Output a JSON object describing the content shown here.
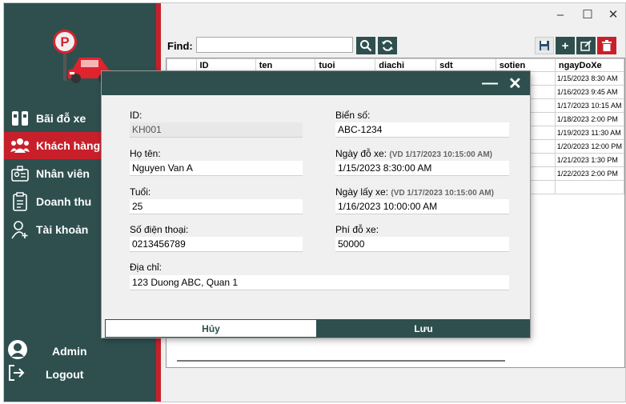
{
  "window": {
    "min_symbol": "–",
    "max_symbol": "☐",
    "close_symbol": "✕"
  },
  "sidebar": {
    "items": [
      {
        "label": "Bãi đỗ xe",
        "icon": "parking-lot-icon"
      },
      {
        "label": "Khách hàng",
        "icon": "users-icon",
        "active": true
      },
      {
        "label": "Nhân viên",
        "icon": "staff-icon"
      },
      {
        "label": "Doanh thu",
        "icon": "revenue-icon"
      },
      {
        "label": "Tài khoản",
        "icon": "add-account-icon"
      }
    ],
    "user_label": "Admin",
    "logout_label": "Logout",
    "colors": {
      "background": "#2f4f4f",
      "accent": "#c8202a"
    }
  },
  "search": {
    "label": "Find:",
    "value": "",
    "placeholder": ""
  },
  "table": {
    "columns": [
      "",
      "ID",
      "ten",
      "tuoi",
      "diachi",
      "sdt",
      "sotien",
      "ngayDoXe"
    ],
    "rows": [
      [
        "1/15/2023 8:30 AM"
      ],
      [
        "1/16/2023 9:45 AM"
      ],
      [
        "1/17/2023 10:15 AM"
      ],
      [
        "1/18/2023 2:00 PM"
      ],
      [
        "1/19/2023 11:30 AM"
      ],
      [
        "1/20/2023 12:00 PM"
      ],
      [
        "1/21/2023 1:30 PM"
      ],
      [
        "1/22/2023 2:00 PM"
      ]
    ]
  },
  "dialog": {
    "id_label": "ID:",
    "id_value": "KH001",
    "name_label": "Họ tên:",
    "name_value": "Nguyen Van A",
    "age_label": "Tuổi:",
    "age_value": "25",
    "phone_label": "Số điện thoại:",
    "phone_value": "0213456789",
    "address_label": "Địa chỉ:",
    "address_value": "123 Duong ABC, Quan 1",
    "plate_label": "Biển số:",
    "plate_value": "ABC-1234",
    "park_label": "Ngày đỗ xe:",
    "park_hint": "(VD 1/17/2023 10:15:00 AM)",
    "park_value": "1/15/2023 8:30:00 AM",
    "pick_label": "Ngày lấy xe:",
    "pick_hint": "(VD 1/17/2023 10:15:00 AM)",
    "pick_value": "1/16/2023 10:00:00 AM",
    "fee_label": "Phí đỗ xe:",
    "fee_value": "50000",
    "cancel_label": "Hủy",
    "save_label": "Lưu",
    "min_symbol": "—",
    "close_symbol": "✕"
  }
}
